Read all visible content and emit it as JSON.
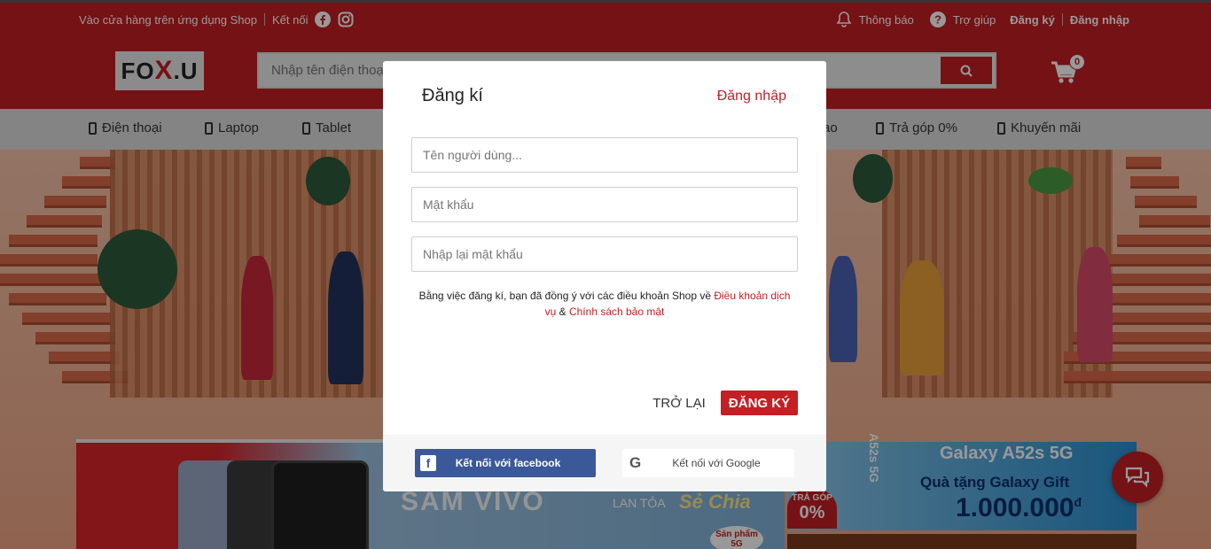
{
  "topbar": {
    "app_store_text": "Vào cửa hàng trên ứng dụng Shop",
    "connect_text": "Kết nối",
    "notifications": "Thông báo",
    "help": "Trợ giúp",
    "register": "Đăng ký",
    "login": "Đăng nhập"
  },
  "logo": {
    "part1": "FO",
    "part2": "X",
    "part3": ".U"
  },
  "search": {
    "placeholder": "Nhập tên điện thoại, máy tính, phụ kiện... cần tìm"
  },
  "cart": {
    "count": "0"
  },
  "menu": {
    "items": [
      {
        "label": "Điện thoại"
      },
      {
        "label": "Laptop"
      },
      {
        "label": "Tablet"
      },
      {
        "label": "Trả góp 0%"
      },
      {
        "label": "Khuyến mãi"
      }
    ],
    "hidden_partial": "ao"
  },
  "promo": {
    "galaxy_title": "Galaxy A52s 5G",
    "galaxy_gift": "Quà tặng Galaxy Gift",
    "galaxy_value": "1.000.000",
    "galaxy_currency": "đ",
    "installment_top": "TRẢ GÓP",
    "installment_value": "0%",
    "model_tag": "A52s 5G",
    "vivo_title": "SĂM VIVO",
    "vivo_sub": "LAN TỎA",
    "vivo_script": "Sẻ Chia",
    "vivo_tag": "Sản phẩm 5G"
  },
  "modal": {
    "title": "Đăng kí",
    "switch_link": "Đăng nhập",
    "username_placeholder": "Tên người dùng...",
    "password_placeholder": "Mật khẩu",
    "confirm_placeholder": "Nhập lại mật khẩu",
    "terms_prefix": "Bằng việc đăng kí, bạn đã đồng ý với các điều khoản Shop về ",
    "terms_link1": "Điều khoản dịch vụ",
    "terms_and": " & ",
    "terms_link2": "Chính sách bảo mật",
    "back_label": "TRỞ LẠI",
    "submit_label": "ĐĂNG KÝ",
    "facebook_label": "Kết nối với facebook",
    "google_label": "Kết nối với Google"
  },
  "colors": {
    "brand": "#c41f24",
    "facebook": "#3b5998"
  }
}
